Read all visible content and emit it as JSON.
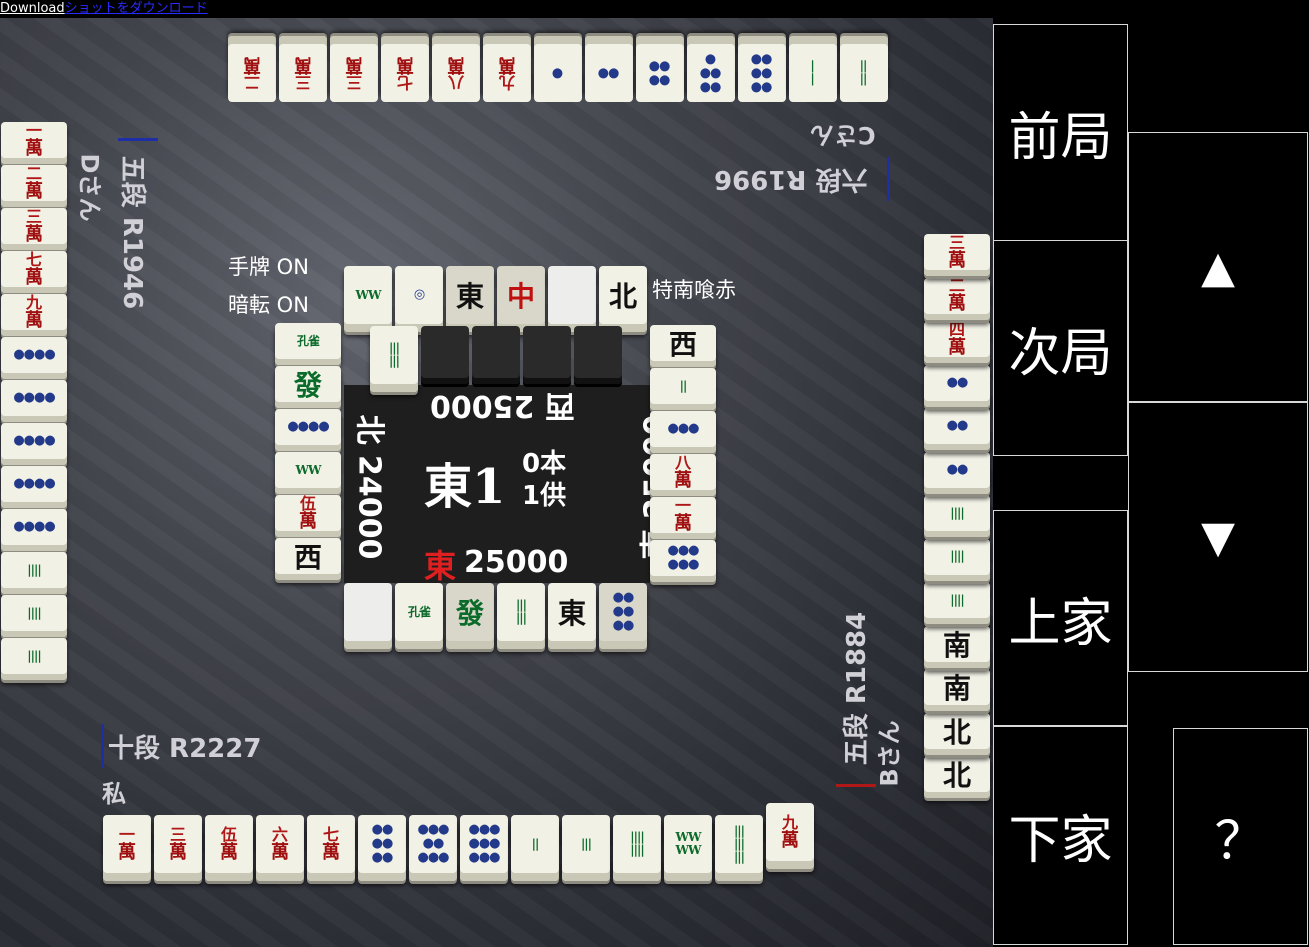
{
  "topbar": {
    "download": "Download",
    "download_jp": "ショットをダウンロード"
  },
  "players": {
    "me": {
      "rank": "十段 R2227",
      "name": "私"
    },
    "shimocha": {
      "rank": "五段 R1884",
      "name": "Bさん"
    },
    "toimen": {
      "rank": "六段 R1996",
      "name": "Cさん"
    },
    "kamicha": {
      "rank": "五段 R1946",
      "name": "Dさん"
    }
  },
  "options": {
    "tehai": "手牌 ON",
    "ankan": "暗転 ON",
    "rule": "特南喰赤"
  },
  "center": {
    "round": "東1",
    "honba": "0本",
    "kyotaku": "1供",
    "east_label": "東",
    "east_score": "25000",
    "south_score": "南 25000",
    "west_score": "西 25000",
    "north_score": "北 24000"
  },
  "buttons": {
    "prev_round": "前局",
    "next_round": "次局",
    "up": "▲",
    "down": "▼",
    "kamicha": "上家",
    "shimocha": "下家",
    "help": "？"
  },
  "tiles": {
    "my_hand": [
      {
        "top": "一",
        "bot": "萬"
      },
      {
        "top": "三",
        "bot": "萬"
      },
      {
        "top": "伍",
        "bot": "萬"
      },
      {
        "top": "六",
        "bot": "萬"
      },
      {
        "top": "七",
        "bot": "萬"
      },
      {
        "pin": "●●\n●●\n●●"
      },
      {
        "pin": "●●●\n●●\n●●●"
      },
      {
        "pin": "●●●\n●●●\n●●●"
      },
      {
        "sou": "||"
      },
      {
        "sou": "|||"
      },
      {
        "sou": "||||\n||||"
      },
      {
        "sou": "WW\nWW"
      },
      {
        "sou": "|||\n|||\n|||"
      }
    ],
    "my_draw": {
      "top": "九",
      "bot": "萬"
    },
    "toimen_hand": [
      {
        "top": "二",
        "bot": "萬"
      },
      {
        "top": "三",
        "bot": "萬"
      },
      {
        "top": "三",
        "bot": "萬"
      },
      {
        "top": "七",
        "bot": "萬"
      },
      {
        "top": "八",
        "bot": "萬"
      },
      {
        "top": "九",
        "bot": "萬"
      },
      {
        "pin": "●"
      },
      {
        "pin": "●●"
      },
      {
        "pin": "●●\n●●"
      },
      {
        "pin": "●●\n●●\n●"
      },
      {
        "pin": "●●\n●●\n●●"
      },
      {
        "sou": "|\n|"
      },
      {
        "sou": "||\n||"
      }
    ],
    "kamicha_hand": [
      {
        "top": "一",
        "bot": "萬"
      },
      {
        "top": "二",
        "bot": "萬"
      },
      {
        "top": "三",
        "bot": "萬"
      },
      {
        "top": "七",
        "bot": "萬"
      },
      {
        "top": "九",
        "bot": "萬"
      },
      {
        "pin": "●●●●"
      },
      {
        "pin": "●●●●"
      },
      {
        "pin": "●●●●"
      },
      {
        "pin": "●●●●"
      },
      {
        "pin": "●●●●"
      },
      {
        "sou": "||||"
      },
      {
        "sou": "||||"
      },
      {
        "sou": "||||"
      }
    ],
    "shimocha_hand": [
      {
        "honor": "北"
      },
      {
        "honor": "北"
      },
      {
        "honor": "南"
      },
      {
        "honor": "南"
      },
      {
        "sou": "||||"
      },
      {
        "sou": "||||"
      },
      {
        "sou": "||||"
      },
      {
        "pin": "●●"
      },
      {
        "pin": "●●"
      },
      {
        "pin": "●●"
      },
      {
        "top": "四",
        "bot": "萬"
      },
      {
        "top": "二",
        "bot": "萬"
      },
      {
        "top": "三",
        "bot": "萬"
      }
    ],
    "discard_me": [
      {
        "type": "empty"
      },
      {
        "sou": "孔雀"
      },
      {
        "honor": "發",
        "color": "green"
      },
      {
        "sou": "|||\n|||"
      },
      {
        "honor": "東"
      },
      {
        "pin": "●●\n●●\n●●"
      }
    ],
    "discard_toimen": [
      {
        "sou": "WW"
      },
      {
        "pin": "◎"
      },
      {
        "honor": "東"
      },
      {
        "honor": "中",
        "color": "red"
      },
      {
        "type": "empty"
      },
      {
        "honor": "北"
      }
    ],
    "discard_toimen_row2": [
      {
        "sou": "|||\n|||"
      }
    ],
    "discard_kamicha": [
      {
        "sou": "孔雀"
      },
      {
        "honor": "發",
        "color": "green"
      },
      {
        "pin": "●●●●"
      },
      {
        "sou": "WW"
      },
      {
        "top": "伍",
        "bot": "萬"
      },
      {
        "honor": "西"
      }
    ],
    "discard_shimocha": [
      {
        "honor": "西"
      },
      {
        "sou": "||"
      },
      {
        "pin": "●●●"
      },
      {
        "top": "八",
        "bot": "萬"
      },
      {
        "top": "一",
        "bot": "萬"
      },
      {
        "pin": "●●●\n●●●"
      }
    ]
  }
}
